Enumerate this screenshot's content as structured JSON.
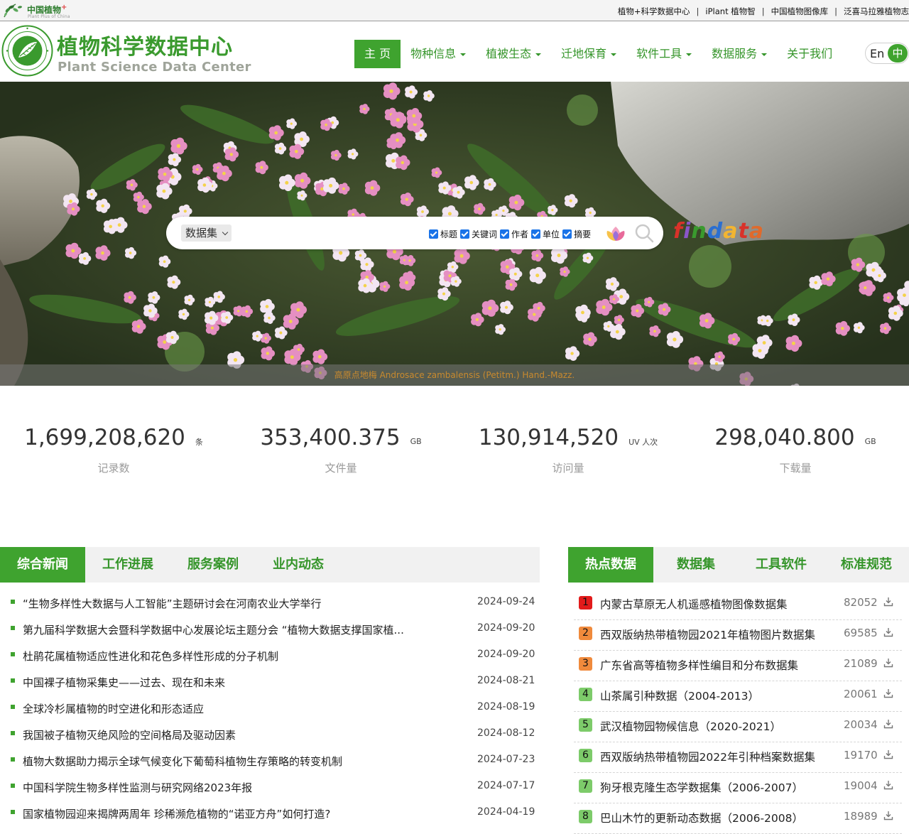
{
  "topbar": {
    "mini_logo_title": "中国植物",
    "mini_logo_plus": "+",
    "mini_logo_sub": "Plant Plus of China",
    "links": [
      "植物+科学数据中心",
      "iPlant 植物智",
      "中国植物图像库",
      "泛喜马拉雅植物志"
    ]
  },
  "header": {
    "title": "植物科学数据中心",
    "subtitle": "Plant Science Data Center",
    "nav": [
      {
        "label": "主 页",
        "dropdown": false,
        "active": true
      },
      {
        "label": "物种信息",
        "dropdown": true
      },
      {
        "label": "植被生态",
        "dropdown": true
      },
      {
        "label": "迁地保育",
        "dropdown": true
      },
      {
        "label": "软件工具",
        "dropdown": true
      },
      {
        "label": "数据服务",
        "dropdown": true
      },
      {
        "label": "关于我们",
        "dropdown": false
      }
    ],
    "lang_en": "En",
    "lang_zh": "中"
  },
  "hero": {
    "search_scope": "数据集",
    "filters": [
      "标题",
      "关键词",
      "作者",
      "单位",
      "摘要"
    ],
    "findata": "findata",
    "caption": "高原点地梅 Androsace zambalensis (Petitm.) Hand.-Mazz."
  },
  "stats": [
    {
      "value": "1,699,208,620",
      "unit": "条",
      "label": "记录数"
    },
    {
      "value": "353,400.375",
      "unit": "GB",
      "label": "文件量"
    },
    {
      "value": "130,914,520",
      "unit": "UV 人次",
      "label": "访问量"
    },
    {
      "value": "298,040.800",
      "unit": "GB",
      "label": "下载量"
    }
  ],
  "news_tabs": [
    "综合新闻",
    "工作进展",
    "服务案例",
    "业内动态"
  ],
  "news": [
    {
      "title": "“生物多样性大数据与人工智能”主题研讨会在河南农业大学举行",
      "date": "2024-09-24"
    },
    {
      "title": "第九届科学数据大会暨科学数据中心发展论坛主题分会 “植物大数据支撑国家植...",
      "date": "2024-09-20"
    },
    {
      "title": "杜鹃花属植物适应性进化和花色多样性形成的分子机制",
      "date": "2024-09-20"
    },
    {
      "title": "中国裸子植物采集史——过去、现在和未来",
      "date": "2024-08-21"
    },
    {
      "title": "全球冷杉属植物的时空进化和形态适应",
      "date": "2024-08-19"
    },
    {
      "title": "我国被子植物灭绝风险的空间格局及驱动因素",
      "date": "2024-08-12"
    },
    {
      "title": "植物大数据助力揭示全球气候变化下葡萄科植物生存策略的转变机制",
      "date": "2024-07-23"
    },
    {
      "title": "中国科学院生物多样性监测与研究网络2023年报",
      "date": "2024-07-17"
    },
    {
      "title": "国家植物园迎来揭牌两周年 珍稀濒危植物的“诺亚方舟”如何打造?",
      "date": "2024-04-19"
    }
  ],
  "hot_tabs": [
    "热点数据",
    "数据集",
    "工具软件",
    "标准规范"
  ],
  "hot": [
    {
      "rank": "1",
      "name": "内蒙古草原无人机遥感植物图像数据集",
      "count": "82052",
      "color": "#e21b1b"
    },
    {
      "rank": "2",
      "name": "西双版纳热带植物园2021年植物图片数据集",
      "count": "69585",
      "color": "#f08a3c"
    },
    {
      "rank": "3",
      "name": "广东省高等植物多样性编目和分布数据集",
      "count": "21089",
      "color": "#f08a3c"
    },
    {
      "rank": "4",
      "name": "山茶属引种数据（2004-2013）",
      "count": "20061",
      "color": "#7dcb6a"
    },
    {
      "rank": "5",
      "name": "武汉植物园物候信息（2020-2021）",
      "count": "20034",
      "color": "#7dcb6a"
    },
    {
      "rank": "6",
      "name": "西双版纳热带植物园2022年引种档案数据集",
      "count": "19170",
      "color": "#7dcb6a"
    },
    {
      "rank": "7",
      "name": "狗牙根克隆生态学数据集（2006-2007）",
      "count": "19004",
      "color": "#7dcb6a"
    },
    {
      "rank": "8",
      "name": "巴山木竹的更新动态数据（2006-2008）",
      "count": "18989",
      "color": "#7dcb6a"
    }
  ],
  "colors": {
    "brand_green": "#3fa32f",
    "title_green": "#3a9a2e"
  }
}
